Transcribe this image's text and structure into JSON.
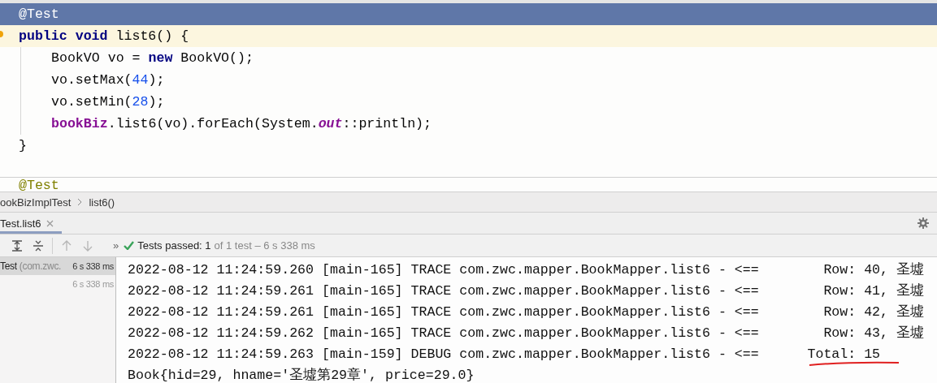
{
  "editor": {
    "lines": [
      {
        "selected": true,
        "current": false,
        "tokens": [
          {
            "kind": "annotation",
            "text": "@Test"
          }
        ]
      },
      {
        "selected": false,
        "current": true,
        "tokens": [
          {
            "kind": "keyword",
            "text": "public void"
          },
          {
            "kind": "plain",
            "text": " list6() {"
          }
        ],
        "children": [
          {
            "selected": false,
            "current": false,
            "tokens": [
              {
                "kind": "plain",
                "text": "BookVO vo = "
              },
              {
                "kind": "keyword",
                "text": "new"
              },
              {
                "kind": "plain",
                "text": " BookVO();"
              }
            ]
          },
          {
            "selected": false,
            "current": false,
            "tokens": [
              {
                "kind": "plain",
                "text": "vo.setMax("
              },
              {
                "kind": "number",
                "text": "44"
              },
              {
                "kind": "plain",
                "text": ");"
              }
            ]
          },
          {
            "selected": false,
            "current": false,
            "tokens": [
              {
                "kind": "plain",
                "text": "vo.setMin("
              },
              {
                "kind": "number",
                "text": "28"
              },
              {
                "kind": "plain",
                "text": ");"
              }
            ]
          },
          {
            "selected": false,
            "current": false,
            "tokens": [
              {
                "kind": "field",
                "text": "bookBiz"
              },
              {
                "kind": "plain",
                "text": ".list6(vo).forEach(System."
              },
              {
                "kind": "static",
                "text": "out"
              },
              {
                "kind": "plain",
                "text": "::println);"
              }
            ]
          }
        ]
      },
      {
        "selected": false,
        "current": false,
        "tokens": [
          {
            "kind": "plain",
            "text": "}"
          }
        ]
      }
    ],
    "next_line": {
      "selected": false,
      "current": false,
      "tokens": [
        {
          "kind": "annotation",
          "text": "@Test"
        }
      ]
    }
  },
  "breadcrumbs": [
    "ookBizImplTest",
    "list6()"
  ],
  "tabs": [
    {
      "label": "Test.list6",
      "selected": true
    }
  ],
  "toolbar": {
    "buttons": [
      {
        "kind": "expand",
        "disabled": false
      },
      {
        "kind": "collapse",
        "disabled": false
      },
      {
        "kind": "up",
        "disabled": true
      },
      {
        "kind": "down",
        "disabled": true
      }
    ],
    "more": "»",
    "status": {
      "passed": "Tests passed: 1",
      "detail": "of 1 test – 6 s 338 ms"
    }
  },
  "tree": [
    {
      "label": "Test",
      "package": "(com.zwc.",
      "time": "6 s 338 ms",
      "selected": true
    },
    {
      "time": "6 s 338 ms",
      "selected": false
    }
  ],
  "console": [
    {
      "text": "2022-08-12 11:24:59.260 [main-165] TRACE com.zwc.mapper.BookMapper.list6 - <==        Row: 40, 圣墟",
      "marked": false
    },
    {
      "text": "2022-08-12 11:24:59.261 [main-165] TRACE com.zwc.mapper.BookMapper.list6 - <==        Row: 41, 圣墟",
      "marked": false
    },
    {
      "text": "2022-08-12 11:24:59.261 [main-165] TRACE com.zwc.mapper.BookMapper.list6 - <==        Row: 42, 圣墟",
      "marked": false
    },
    {
      "text": "2022-08-12 11:24:59.262 [main-165] TRACE com.zwc.mapper.BookMapper.list6 - <==        Row: 43, 圣墟",
      "marked": false
    },
    {
      "text": "2022-08-12 11:24:59.263 [main-159] DEBUG com.zwc.mapper.BookMapper.list6 - <==      Total: 15",
      "marked": true
    },
    {
      "text": "Book{hid=29, hname='圣墟第29章', price=29.0}",
      "marked": false
    }
  ]
}
